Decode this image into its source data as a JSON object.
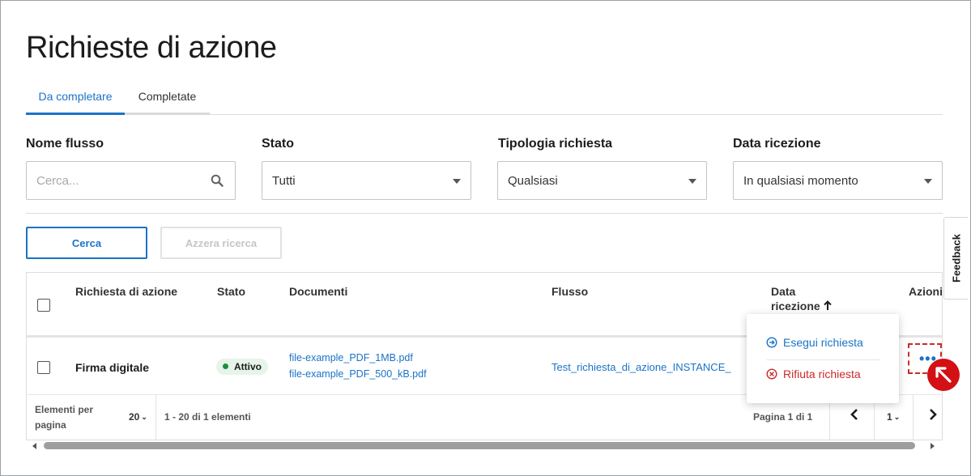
{
  "page": {
    "title": "Richieste di azione"
  },
  "tabs": [
    {
      "label": "Da completare",
      "active": true
    },
    {
      "label": "Completate",
      "active": false
    }
  ],
  "filters": {
    "nome_flusso": {
      "label": "Nome flusso",
      "placeholder": "Cerca..."
    },
    "stato": {
      "label": "Stato",
      "value": "Tutti"
    },
    "tipologia": {
      "label": "Tipologia richiesta",
      "value": "Qualsiasi"
    },
    "data": {
      "label": "Data ricezione",
      "value": "In qualsiasi momento"
    }
  },
  "buttons": {
    "search": "Cerca",
    "reset": "Azzera ricerca"
  },
  "table": {
    "columns": {
      "richiesta": "Richiesta di azione",
      "stato": "Stato",
      "documenti": "Documenti",
      "flusso": "Flusso",
      "data_line1": "Data",
      "data_line2": "ricezione",
      "azioni": "Azioni"
    },
    "rows": [
      {
        "name": "Firma digitale",
        "status": "Attivo",
        "documents": [
          "file-example_PDF_1MB.pdf",
          "file-example_PDF_500_kB.pdf"
        ],
        "flow": "Test_richiesta_di_azione_INSTANCE_"
      }
    ],
    "footer": {
      "per_page_line1": "Elementi per",
      "per_page_line2": "pagina",
      "per_page_value": "20",
      "range": "1 - 20 di 1 elementi",
      "page_info": "Pagina 1 di 1",
      "page_select": "1"
    }
  },
  "menu": {
    "execute": "Esegui richiesta",
    "reject": "Rifiuta richiesta"
  },
  "feedback": "Feedback",
  "colors": {
    "primary": "#1a73c7",
    "danger": "#cc2a2a",
    "success": "#1e8e3e",
    "cursor": "#d31014"
  }
}
